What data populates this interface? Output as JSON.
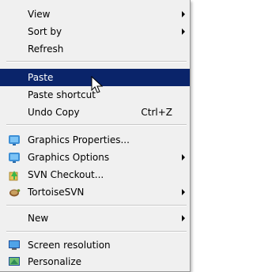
{
  "menu": {
    "view": "View",
    "sort_by": "Sort by",
    "refresh": "Refresh",
    "paste": "Paste",
    "paste_shortcut": "Paste shortcut",
    "undo_copy": "Undo Copy",
    "undo_copy_shortcut": "Ctrl+Z",
    "graphics_properties": "Graphics Properties...",
    "graphics_options": "Graphics Options",
    "svn_checkout": "SVN Checkout...",
    "tortoisesvn": "TortoiseSVN",
    "new": "New",
    "screen_resolution": "Screen resolution",
    "personalize": "Personalize"
  },
  "colors": {
    "menu_background": "#f0f0f0",
    "highlight": "#0a246a",
    "highlight_text": "#ffffff"
  },
  "icons": {
    "graphics_properties": "intel-graphics-icon",
    "graphics_options": "intel-graphics-icon",
    "svn_checkout": "svn-checkout-icon",
    "tortoisesvn": "tortoisesvn-icon",
    "screen_resolution": "monitor-icon",
    "personalize": "personalize-icon"
  }
}
